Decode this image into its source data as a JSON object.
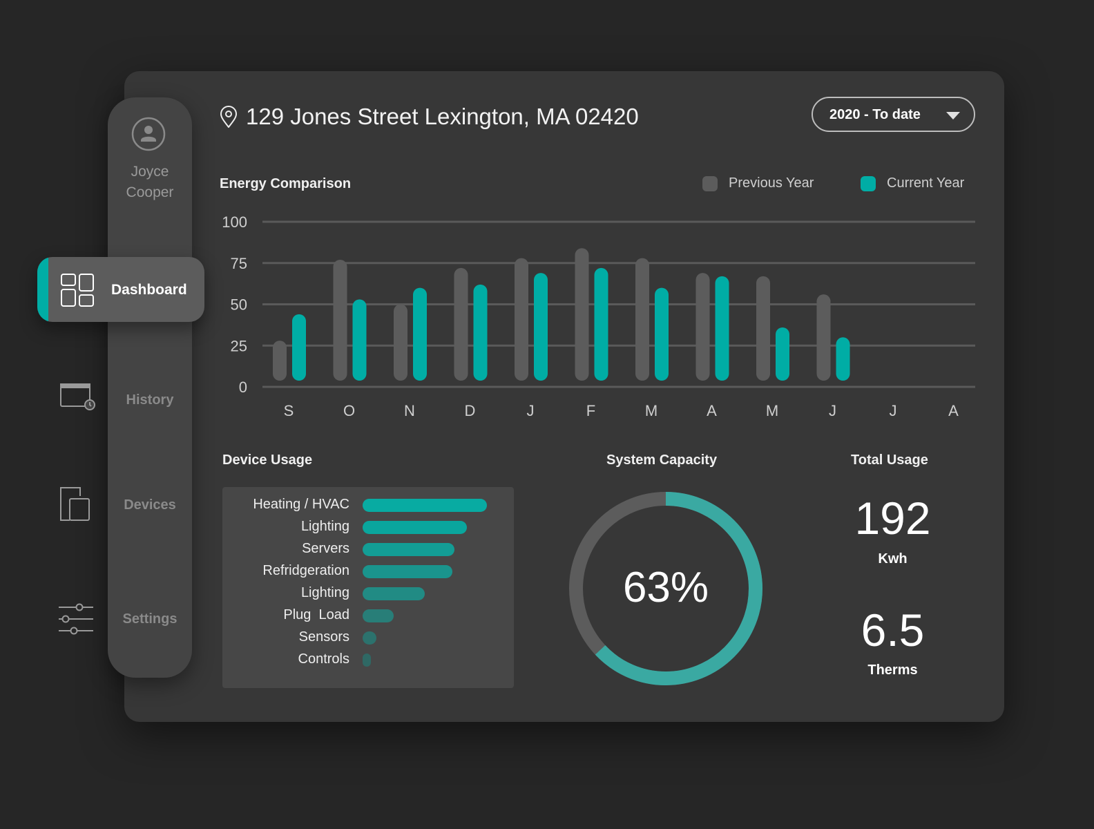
{
  "user": {
    "name_line1": "Joyce",
    "name_line2": "Cooper"
  },
  "nav": [
    {
      "label": "Dashboard",
      "icon": "dashboard-icon",
      "active": true
    },
    {
      "label": "History",
      "icon": "history-icon"
    },
    {
      "label": "Devices",
      "icon": "devices-icon"
    },
    {
      "label": "Settings",
      "icon": "settings-icon"
    }
  ],
  "header": {
    "address": "129 Jones Street Lexington, MA 02420",
    "range": "2020 - To date"
  },
  "colors": {
    "accent": "#00ada5",
    "previous": "#5c5c5c",
    "bg": "#373737"
  },
  "energy": {
    "title": "Energy Comparison",
    "legend_prev": "Previous Year",
    "legend_cur": "Current Year"
  },
  "chart_data": {
    "type": "bar",
    "title": "Energy Comparison",
    "categories": [
      "S",
      "O",
      "N",
      "D",
      "J",
      "F",
      "M",
      "A",
      "M",
      "J",
      "J",
      "A"
    ],
    "yticks": [
      "100",
      "75",
      "50",
      "25",
      "0"
    ],
    "ylim": [
      0,
      100
    ],
    "series": [
      {
        "name": "Previous Year",
        "values": [
          28,
          77,
          50,
          72,
          78,
          84,
          78,
          69,
          67,
          56,
          null,
          null
        ]
      },
      {
        "name": "Current Year",
        "values": [
          44,
          53,
          60,
          62,
          69,
          72,
          60,
          67,
          36,
          30,
          null,
          null
        ]
      }
    ]
  },
  "device_usage": {
    "title": "Device Usage",
    "items": [
      {
        "label": "Heating / HVAC",
        "value": 100
      },
      {
        "label": "Lighting",
        "value": 84
      },
      {
        "label": "Servers",
        "value": 74
      },
      {
        "label": "Refridgeration",
        "value": 72
      },
      {
        "label": "Lighting",
        "value": 50
      },
      {
        "label": "Plug  Load",
        "value": 25
      },
      {
        "label": "Sensors",
        "value": 11
      },
      {
        "label": "Controls",
        "value": 6
      }
    ]
  },
  "capacity": {
    "title": "System Capacity",
    "value": 63,
    "label": "63%"
  },
  "total": {
    "title": "Total Usage",
    "kwh": "192",
    "kwh_unit": "Kwh",
    "therms": "6.5",
    "therms_unit": "Therms"
  }
}
